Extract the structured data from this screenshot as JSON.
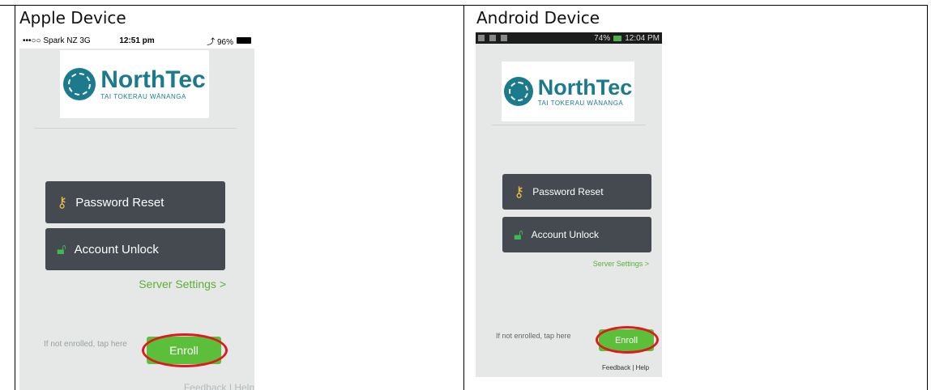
{
  "table": {
    "left_header": "Apple Device",
    "right_header": "Android Device"
  },
  "ios": {
    "status_carrier": "•••○○ Spark NZ  3G",
    "status_time": "12:51 pm",
    "status_battery": "⤴ 96%",
    "logo_main": "NorthTec",
    "logo_sub": "TAI TOKERAU WĀNANGA",
    "password_reset": "Password Reset",
    "account_unlock": "Account Unlock",
    "server_settings": "Server Settings >",
    "enroll_hint": "If not enrolled, tap here",
    "enroll": "Enroll",
    "footer": "Feedback | Help"
  },
  "android": {
    "status_time": "12:04 PM",
    "status_battery": "74%",
    "logo_main": "NorthTec",
    "logo_sub": "TAI TOKERAU WĀNANGA",
    "password_reset": "Password Reset",
    "account_unlock": "Account Unlock",
    "server_settings": "Server Settings >",
    "enroll_hint": "If not enrolled, tap here",
    "enroll": "Enroll",
    "footer": "Feedback | Help"
  },
  "colors": {
    "button_dark": "#444a4f",
    "accent_green": "#5bbf3a",
    "brand_teal": "#1b7a8c",
    "highlight_red": "#e0191e"
  },
  "icons": [
    "key-icon",
    "lock-icon",
    "battery-icon",
    "signal-icon"
  ]
}
